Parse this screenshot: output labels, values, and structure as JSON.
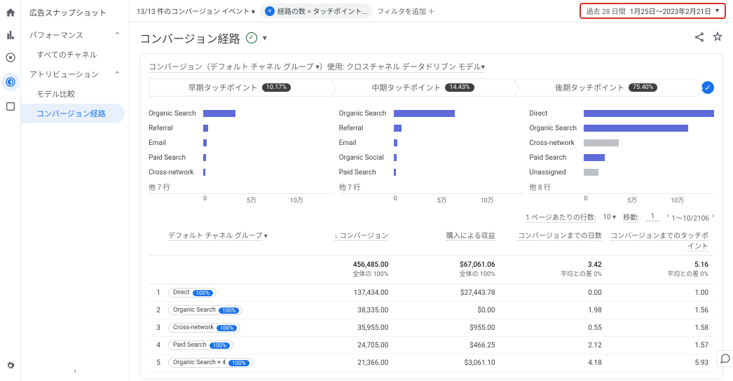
{
  "sidebar": {
    "title": "広告スナップショット",
    "sections": [
      {
        "label": "パフォーマンス",
        "items": [
          "すべてのチャネル"
        ]
      },
      {
        "label": "アトリビューション",
        "items": [
          "モデル比較",
          "コンバージョン経路"
        ]
      }
    ]
  },
  "topbar": {
    "conv_events": "13/13 件のコンバージョン イベント",
    "path_chip": "経路の数 = タッチポイント...",
    "add_filter": "フィルタを追加",
    "date_label": "過去 28 日間",
    "date_range": "1月25日～2023年2月21日"
  },
  "page": {
    "title": "コンバージョン経路"
  },
  "card": {
    "subheader": "コンバージョン（デフォルト チャネル グループ ▾）使用: クロスチャネル データドリブン モデル▾",
    "tabs": [
      {
        "label": "早期タッチポイント",
        "pct": "10.17%"
      },
      {
        "label": "中期タッチポイント",
        "pct": "14.43%"
      },
      {
        "label": "後期タッチポイント",
        "pct": "75.40%"
      }
    ]
  },
  "chart_data": [
    {
      "type": "bar",
      "more": "他 7 行",
      "xlim": [
        0,
        100000
      ],
      "ticks": [
        "0",
        "5万",
        "10万"
      ],
      "series": [
        {
          "name": "Organic Search",
          "v": 25000,
          "c": "blue"
        },
        {
          "name": "Referral",
          "v": 4000,
          "c": "blue"
        },
        {
          "name": "Email",
          "v": 2500,
          "c": "blue"
        },
        {
          "name": "Paid Search",
          "v": 2000,
          "c": "blue"
        },
        {
          "name": "Cross-network",
          "v": 1500,
          "c": "blue"
        }
      ]
    },
    {
      "type": "bar",
      "more": "他 7 行",
      "xlim": [
        0,
        100000
      ],
      "ticks": [
        "0",
        "5万",
        "10万"
      ],
      "series": [
        {
          "name": "Organic Search",
          "v": 47000,
          "c": "blue"
        },
        {
          "name": "Referral",
          "v": 6000,
          "c": "blue"
        },
        {
          "name": "Email",
          "v": 3000,
          "c": "blue"
        },
        {
          "name": "Organic Social",
          "v": 2500,
          "c": "blue"
        },
        {
          "name": "Paid Search",
          "v": 2000,
          "c": "blue"
        }
      ]
    },
    {
      "type": "bar",
      "more": "他 8 行",
      "xlim": [
        0,
        100000
      ],
      "ticks": [
        "0",
        "5万",
        "10万"
      ],
      "series": [
        {
          "name": "Direct",
          "v": 100000,
          "c": "blue"
        },
        {
          "name": "Organic Search",
          "v": 80000,
          "c": "blue"
        },
        {
          "name": "Cross-network",
          "v": 27000,
          "c": "grey"
        },
        {
          "name": "Paid Search",
          "v": 16000,
          "c": "blue"
        },
        {
          "name": "Unassigned",
          "v": 11000,
          "c": "grey"
        }
      ]
    }
  ],
  "pager": {
    "per_label": "1 ページあたりの行数:",
    "per": "10",
    "go_label": "移動:",
    "go": "1",
    "range": "1～10/2106"
  },
  "table": {
    "headers": {
      "channel": "デフォルト チャネル グループ",
      "conv": "↓ コンバージョン",
      "rev": "購入による収益",
      "days": "コンバージョンまでの日数",
      "tp": "コンバージョンまでのタッチポイント"
    },
    "totals": {
      "conv": "456,485.00",
      "conv_sub": "全体の 100%",
      "rev": "$67,061.06",
      "rev_sub": "全体の 100%",
      "days": "3.42",
      "days_sub": "平均との差 0%",
      "tp": "5.16",
      "tp_sub": "平均との差 0%"
    },
    "rows": [
      {
        "idx": "1",
        "ch": "Direct",
        "pct": "100%",
        "conv": "137,434.00",
        "rev": "$27,443.78",
        "days": "0.00",
        "tp": "1.00"
      },
      {
        "idx": "2",
        "ch": "Organic Search",
        "pct": "100%",
        "conv": "38,335.00",
        "rev": "$0.00",
        "days": "1.98",
        "tp": "1.56"
      },
      {
        "idx": "3",
        "ch": "Cross-network",
        "pct": "100%",
        "conv": "35,955.00",
        "rev": "$955.00",
        "days": "0.55",
        "tp": "1.58"
      },
      {
        "idx": "4",
        "ch": "Paid Search",
        "pct": "100%",
        "conv": "24,705.00",
        "rev": "$466.25",
        "days": "2.12",
        "tp": "1.57"
      },
      {
        "idx": "5",
        "ch": "Organic Search × 4",
        "pct": "100%",
        "conv": "21,366.00",
        "rev": "$3,061.10",
        "days": "4.18",
        "tp": "5.93"
      }
    ]
  }
}
